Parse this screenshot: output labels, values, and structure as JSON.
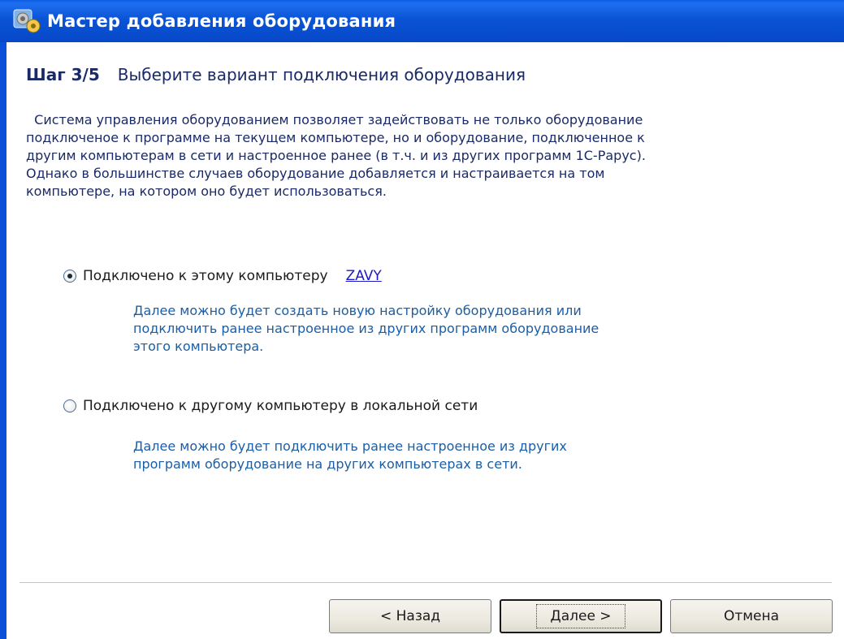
{
  "window": {
    "title": "Мастер добавления оборудования",
    "icon": "gear-wizard-icon"
  },
  "step": {
    "label": "Шаг 3/5",
    "title": "Выберите вариант подключения оборудования"
  },
  "description": [
    "  Система управления оборудованием позволяет задействовать не только оборудование",
    "подключеное к программе на текущем компьютере, но и оборудование, подключенное к",
    "другим компьютерам в сети и настроенное ранее (в т.ч. и из других программ 1С-Рарус).",
    "Однако в большинстве случаев оборудование добавляется и настраивается на том",
    "компьютере, на котором оно будет использоваться."
  ],
  "options": [
    {
      "label": "Подключено к этому компьютеру",
      "computer_name": "ZAVY",
      "checked": true,
      "hint": [
        "Далее можно будет создать новую настройку оборудования или",
        "подключить ранее настроенное из других программ оборудование",
        "этого компьютера."
      ]
    },
    {
      "label": "Подключено к другому компьютеру в локальной сети",
      "checked": false,
      "hint": [
        "Далее можно будет подключить ранее настроенное из других",
        "программ оборудование на других компьютерах в сети."
      ]
    }
  ],
  "buttons": {
    "back": "< Назад",
    "next": "Далее >",
    "cancel": "Отмена"
  },
  "colors": {
    "titlebar": "#0a54d6",
    "heading_text": "#1a2a66",
    "hint_text": "#1a5ea8",
    "link": "#1a1ac8"
  }
}
